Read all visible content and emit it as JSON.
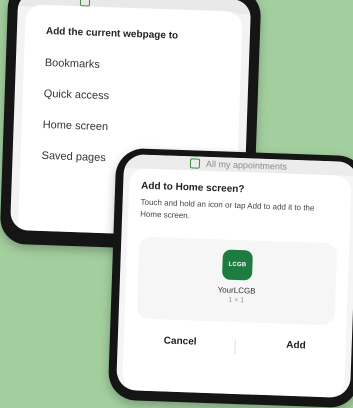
{
  "back_screen": {
    "page_strip_text": "",
    "sheet_title": "Add the current webpage to",
    "menu_items": [
      "Bookmarks",
      "Quick access",
      "Home screen",
      "Saved pages"
    ]
  },
  "front_screen": {
    "page_strip_text": "All my appointments",
    "dialog": {
      "title": "Add to Home screen?",
      "body": "Touch and hold an icon or tap Add to add it to the Home screen.",
      "app_icon_text": "LCGB",
      "app_name": "YourLCGB",
      "app_size": "1 × 1",
      "cancel_label": "Cancel",
      "add_label": "Add"
    }
  },
  "colors": {
    "background": "#a3cf9f",
    "accent_green": "#1d7c3f"
  }
}
